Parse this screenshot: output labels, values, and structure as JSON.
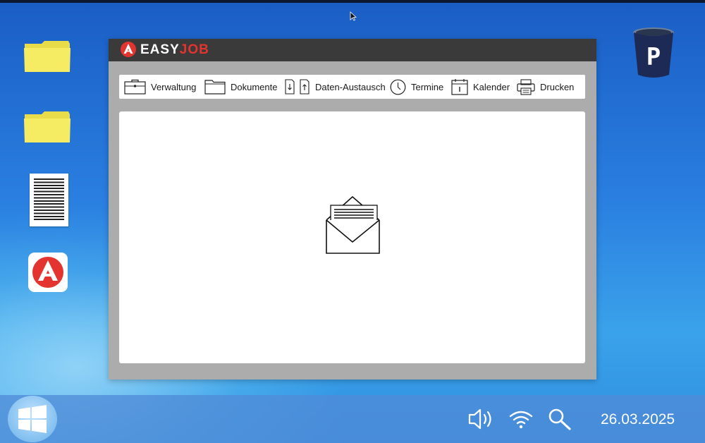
{
  "app": {
    "brand_part1": "EASY",
    "brand_part2": "JOB",
    "brand_color": "#e3342f",
    "titlebar_color": "#3a3a3a"
  },
  "toolbar": {
    "items": [
      {
        "label": "Verwaltung",
        "icon": "briefcase-icon"
      },
      {
        "label": "Dokumente",
        "icon": "folder-icon"
      },
      {
        "label": "Daten-Austausch",
        "icon": "file-exchange-icon"
      },
      {
        "label": "Termine",
        "icon": "clock-icon"
      },
      {
        "label": "Kalender",
        "icon": "calendar-icon"
      },
      {
        "label": "Drucken",
        "icon": "printer-icon"
      }
    ]
  },
  "content": {
    "icon": "open-envelope-icon"
  },
  "desktop": {
    "icons": [
      "folder-icon",
      "folder-icon",
      "document-icon",
      "arbeitsagentur-app-icon",
      "trash-bin-icon"
    ]
  },
  "taskbar": {
    "start_icon": "windows-logo-icon",
    "tray": [
      "speaker-icon",
      "wifi-icon",
      "search-icon"
    ],
    "date": "26.03.2025"
  }
}
